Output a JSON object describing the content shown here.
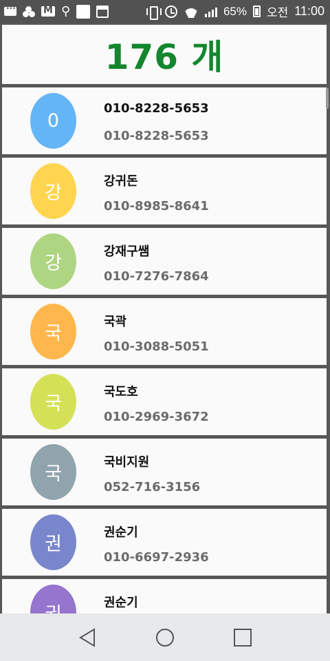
{
  "status_bar": {
    "battery_percent": "65%",
    "am_pm": "오전",
    "time": "11:00",
    "icons": [
      "chat-icon",
      "clover-icon",
      "gmail-icon",
      "usb-icon",
      "square-icon",
      "cleaner-icon",
      "vibrate-icon",
      "alarm-icon",
      "wifi-icon",
      "signal-icon",
      "battery-icon"
    ]
  },
  "header": {
    "count_label": "176 개",
    "color": "#13862e"
  },
  "contacts": [
    {
      "initial": "0",
      "name": "010-8228-5653",
      "phone": "010-8228-5653",
      "color": "#64b5f6"
    },
    {
      "initial": "강",
      "name": "강귀돈",
      "phone": "010-8985-8641",
      "color": "#ffd54f"
    },
    {
      "initial": "강",
      "name": "강재구쌤",
      "phone": "010-7276-7864",
      "color": "#aed581"
    },
    {
      "initial": "국",
      "name": "국곽",
      "phone": "010-3088-5051",
      "color": "#ffb74d"
    },
    {
      "initial": "국",
      "name": "국도호",
      "phone": "010-2969-3672",
      "color": "#d4e157"
    },
    {
      "initial": "국",
      "name": "국비지원",
      "phone": "052-716-3156",
      "color": "#90a4ae"
    },
    {
      "initial": "권",
      "name": "권순기",
      "phone": "010-6697-2936",
      "color": "#7986cb"
    },
    {
      "initial": "권",
      "name": "권순기",
      "phone": "",
      "color": "#9575cd"
    }
  ],
  "nav": {
    "icons": [
      "back-icon",
      "home-icon",
      "recent-apps-icon"
    ]
  }
}
